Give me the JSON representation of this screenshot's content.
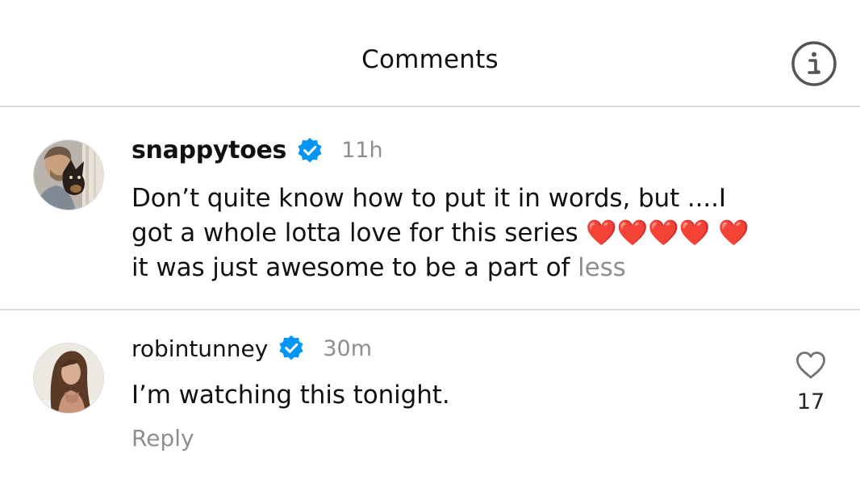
{
  "header": {
    "title": "Comments",
    "info_icon": "info-circle-icon"
  },
  "comments": [
    {
      "username": "snappytoes",
      "verified": true,
      "timestamp": "11h",
      "text": "Don’t quite know how to put it in words, but ....I got a whole lotta love for this series ❤️❤️❤️❤️ ❤️ it was just awesome to be a part of",
      "less_label": "less",
      "avatar_icon": "avatar-man-with-dog"
    },
    {
      "username": "robintunney",
      "verified": true,
      "timestamp": "30m",
      "text": "I’m watching this tonight.",
      "reply_label": "Reply",
      "like_count": "17",
      "like_icon": "heart-outline-icon",
      "avatar_icon": "avatar-woman"
    }
  ],
  "colors": {
    "verified_blue": "#0095f6",
    "muted_text": "#8e8e8e",
    "divider": "#dbdbdb"
  }
}
